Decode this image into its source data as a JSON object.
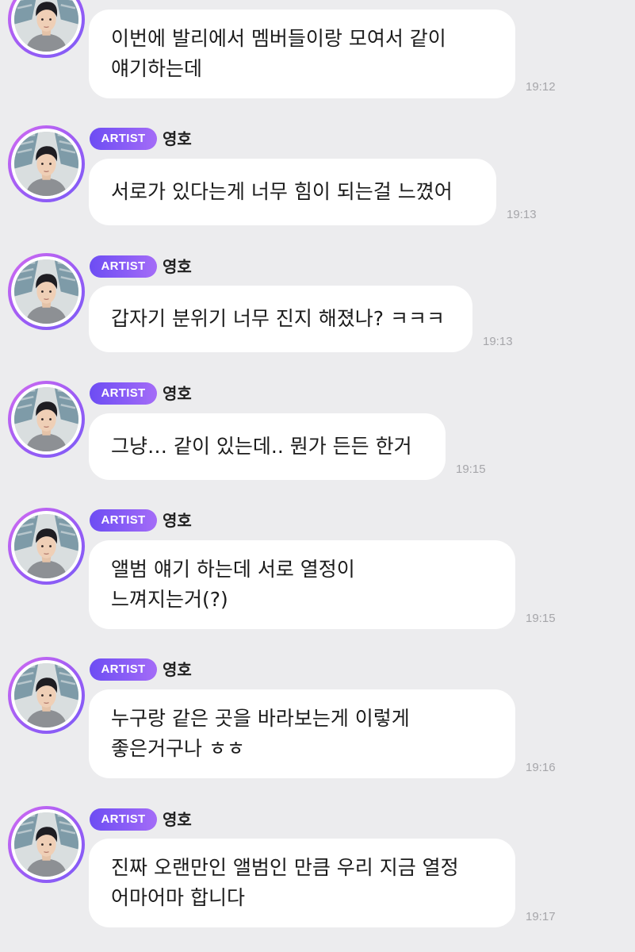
{
  "messages": [
    {
      "badge": "",
      "name": "",
      "lines": [
        "이번에 발리에서 멤버들이랑 모여서 같이",
        "얘기하는데"
      ],
      "time": "19:12"
    },
    {
      "badge": "ARTIST",
      "name": "영호",
      "lines": [
        "서로가 있다는게 너무 힘이 되는걸 느꼈어"
      ],
      "time": "19:13"
    },
    {
      "badge": "ARTIST",
      "name": "영호",
      "lines": [
        "갑자기 분위기 너무 진지 해졌나? ㅋㅋㅋ"
      ],
      "time": "19:13"
    },
    {
      "badge": "ARTIST",
      "name": "영호",
      "lines": [
        "그냥… 같이 있는데.. 뭔가 든든 한거"
      ],
      "time": "19:15"
    },
    {
      "badge": "ARTIST",
      "name": "영호",
      "lines": [
        "앨범 얘기 하는데 서로 열정이",
        "느껴지는거(?)"
      ],
      "time": "19:15"
    },
    {
      "badge": "ARTIST",
      "name": "영호",
      "lines": [
        "누구랑 같은 곳을 바라보는게 이렇게",
        "좋은거구나 ㅎㅎ"
      ],
      "time": "19:16"
    },
    {
      "badge": "ARTIST",
      "name": "영호",
      "lines": [
        "진짜 오랜만인 앨범인 만큼 우리 지금 열정",
        "어마어마 합니다"
      ],
      "time": "19:17"
    }
  ],
  "colors": {
    "background": "#ececee",
    "bubble": "#ffffff",
    "badge": "#7d5cf6",
    "time": "#a6a6aa"
  }
}
